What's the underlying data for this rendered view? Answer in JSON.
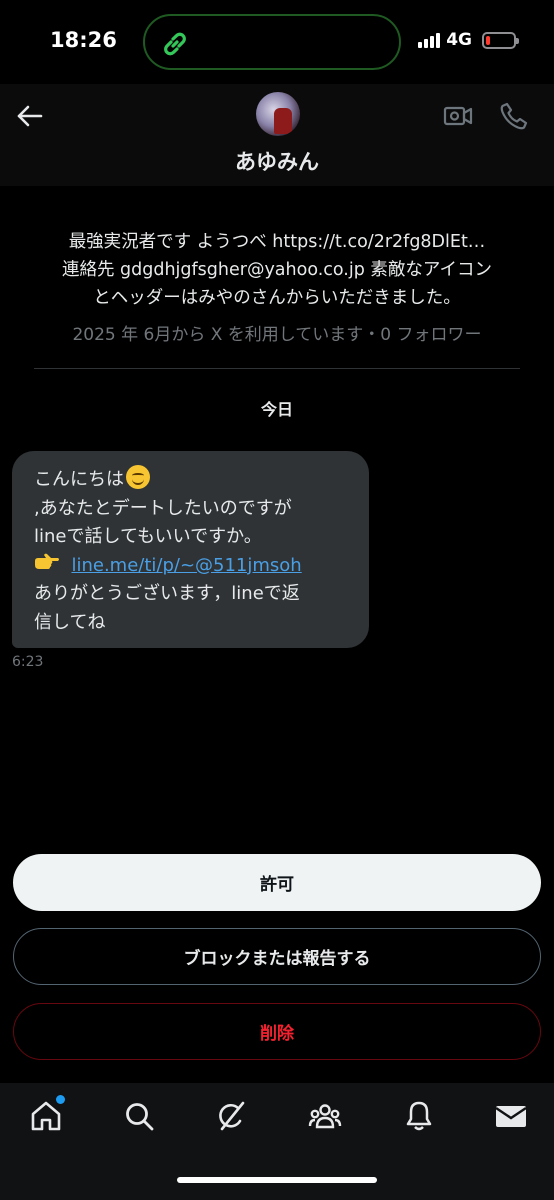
{
  "status_bar": {
    "time": "18:26",
    "network": "4G",
    "battery_level": 0.15,
    "signal_bars": 4
  },
  "header": {
    "back_icon": "arrow-left-icon",
    "display_name": "あゆみん",
    "video_icon": "video-camera-icon",
    "call_icon": "phone-icon"
  },
  "profile": {
    "bio": "最強実況者です ようつべ https://t.co/2r2fg8DlEt…\n連絡先 gdgdhjgfsgher@yahoo.co.jp 素敵なアイコン\nとヘッダーはみやのさんからいただきました。",
    "meta": "2025 年 6月から X を利用しています・0 フォロワー"
  },
  "conversation": {
    "date_label": "今日",
    "message": {
      "line1": "こんにちは",
      "line2": ",あなたとデートしたいのですが",
      "line3": "lineで話してもいいですか。",
      "link": "line.me/ti/p/~@511jmsoh",
      "line5": "ありがとうございます，lineで返",
      "line6": "信してね",
      "time": "6:23"
    }
  },
  "actions": {
    "allow": "許可",
    "block_report": "ブロックまたは報告する",
    "delete": "削除"
  },
  "bottom_nav": {
    "items": [
      "home-icon",
      "search-icon",
      "grok-icon",
      "communities-icon",
      "notifications-icon",
      "messages-icon"
    ]
  },
  "colors": {
    "accent": "#1d9bf0",
    "link": "#4a9fe5",
    "danger": "#f4212e",
    "bubble": "#2f3336"
  }
}
